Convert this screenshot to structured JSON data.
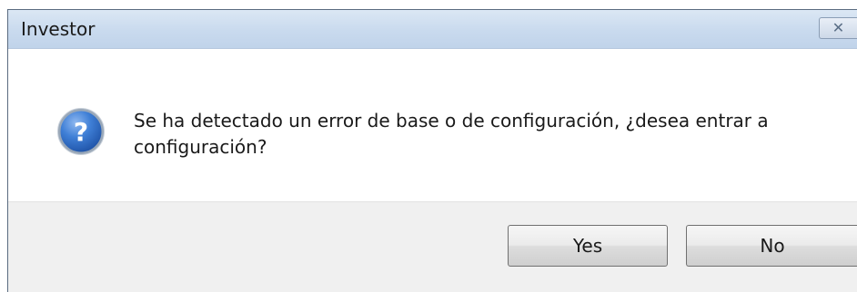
{
  "window": {
    "title": "Investor",
    "close_glyph": "✕",
    "close_icon": "close-icon"
  },
  "message": {
    "icon": "question-icon",
    "text": "Se ha detectado un error de base o de configuración, ¿desea entrar a configuración?"
  },
  "buttons": {
    "yes_label": "Yes",
    "no_label": "No"
  },
  "colors": {
    "titlebar": "#c9daee",
    "footer": "#f0f0f0",
    "icon_blue": "#2a66c4"
  }
}
